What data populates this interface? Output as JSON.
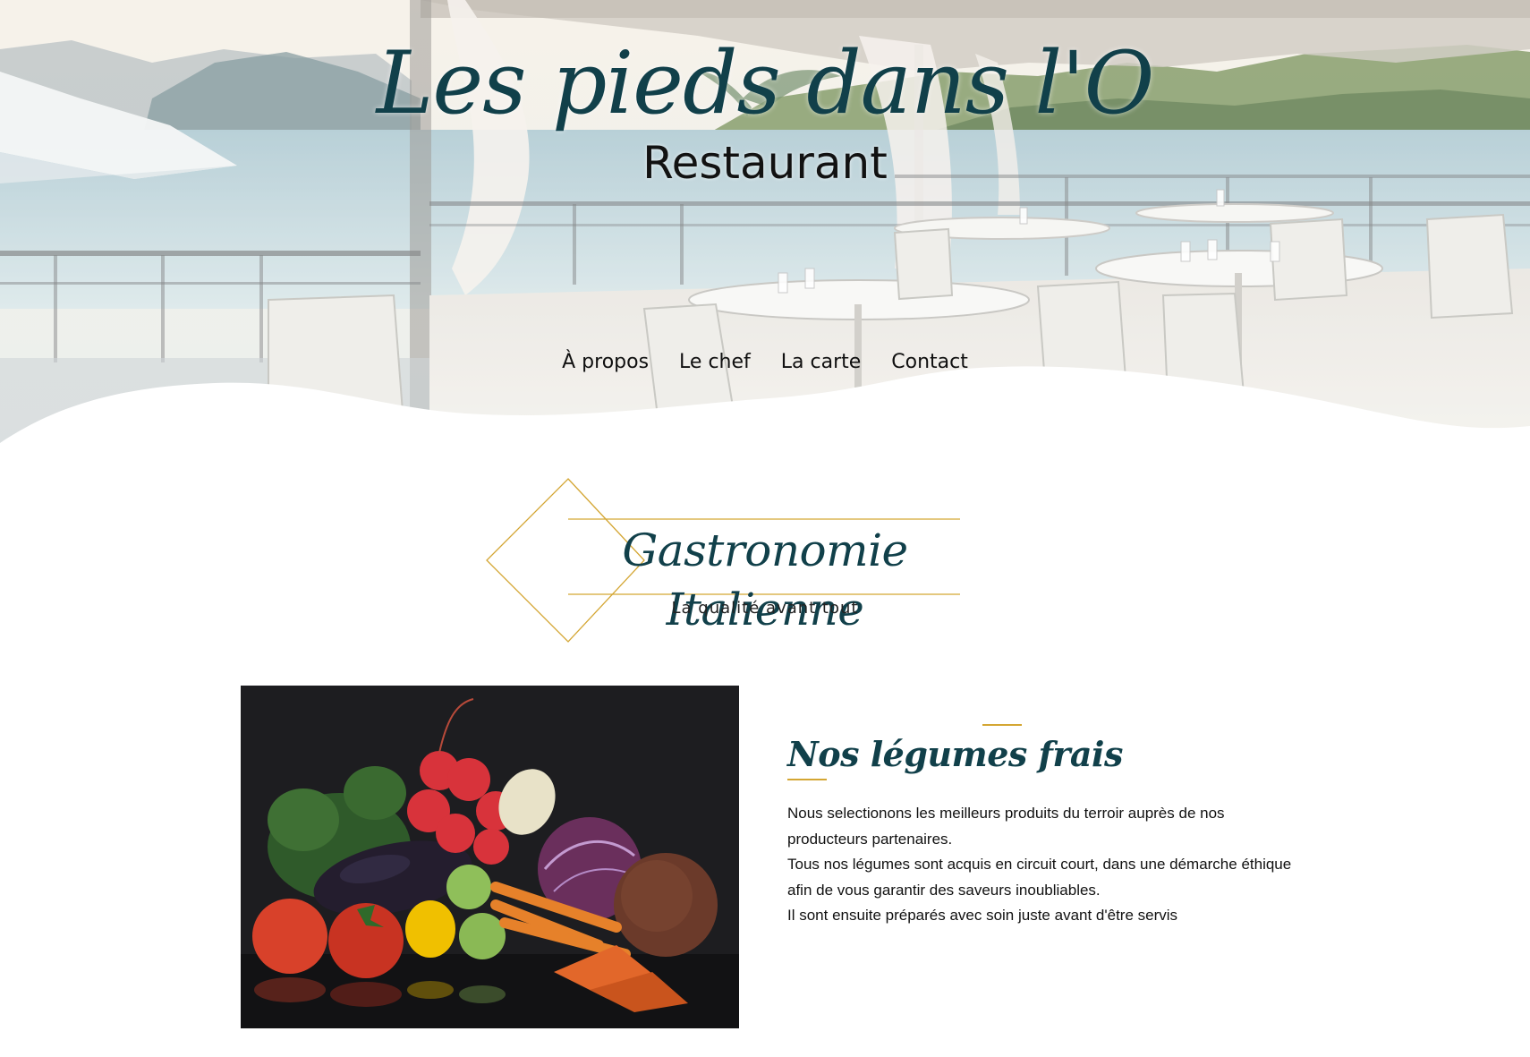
{
  "hero": {
    "title": "Les pieds dans l'O",
    "subtitle": "Restaurant",
    "background_image": "lakeside-terrace-photo"
  },
  "nav": {
    "items": [
      {
        "label": "À propos"
      },
      {
        "label": "Le chef"
      },
      {
        "label": "La carte"
      },
      {
        "label": "Contact"
      }
    ]
  },
  "section": {
    "title": "Gastronomie Italienne",
    "tagline": "La qualité avant tout"
  },
  "article": {
    "image": "fresh-vegetables-photo",
    "title": "Nos légumes frais",
    "lines": [
      "Nous selectionons les meilleurs produits du terroir auprès de nos",
      "producteurs partenaires.",
      "Tous nos légumes sont acquis en circuit court, dans une démarche éthique",
      "afin de vous garantir des saveurs inoubliables.",
      "Il sont ensuite préparés avec soin juste avant d'être servis"
    ]
  },
  "colors": {
    "accent_gold": "#d4a633",
    "title_teal": "#11404a",
    "text_dark": "#111111",
    "background": "#ffffff"
  }
}
